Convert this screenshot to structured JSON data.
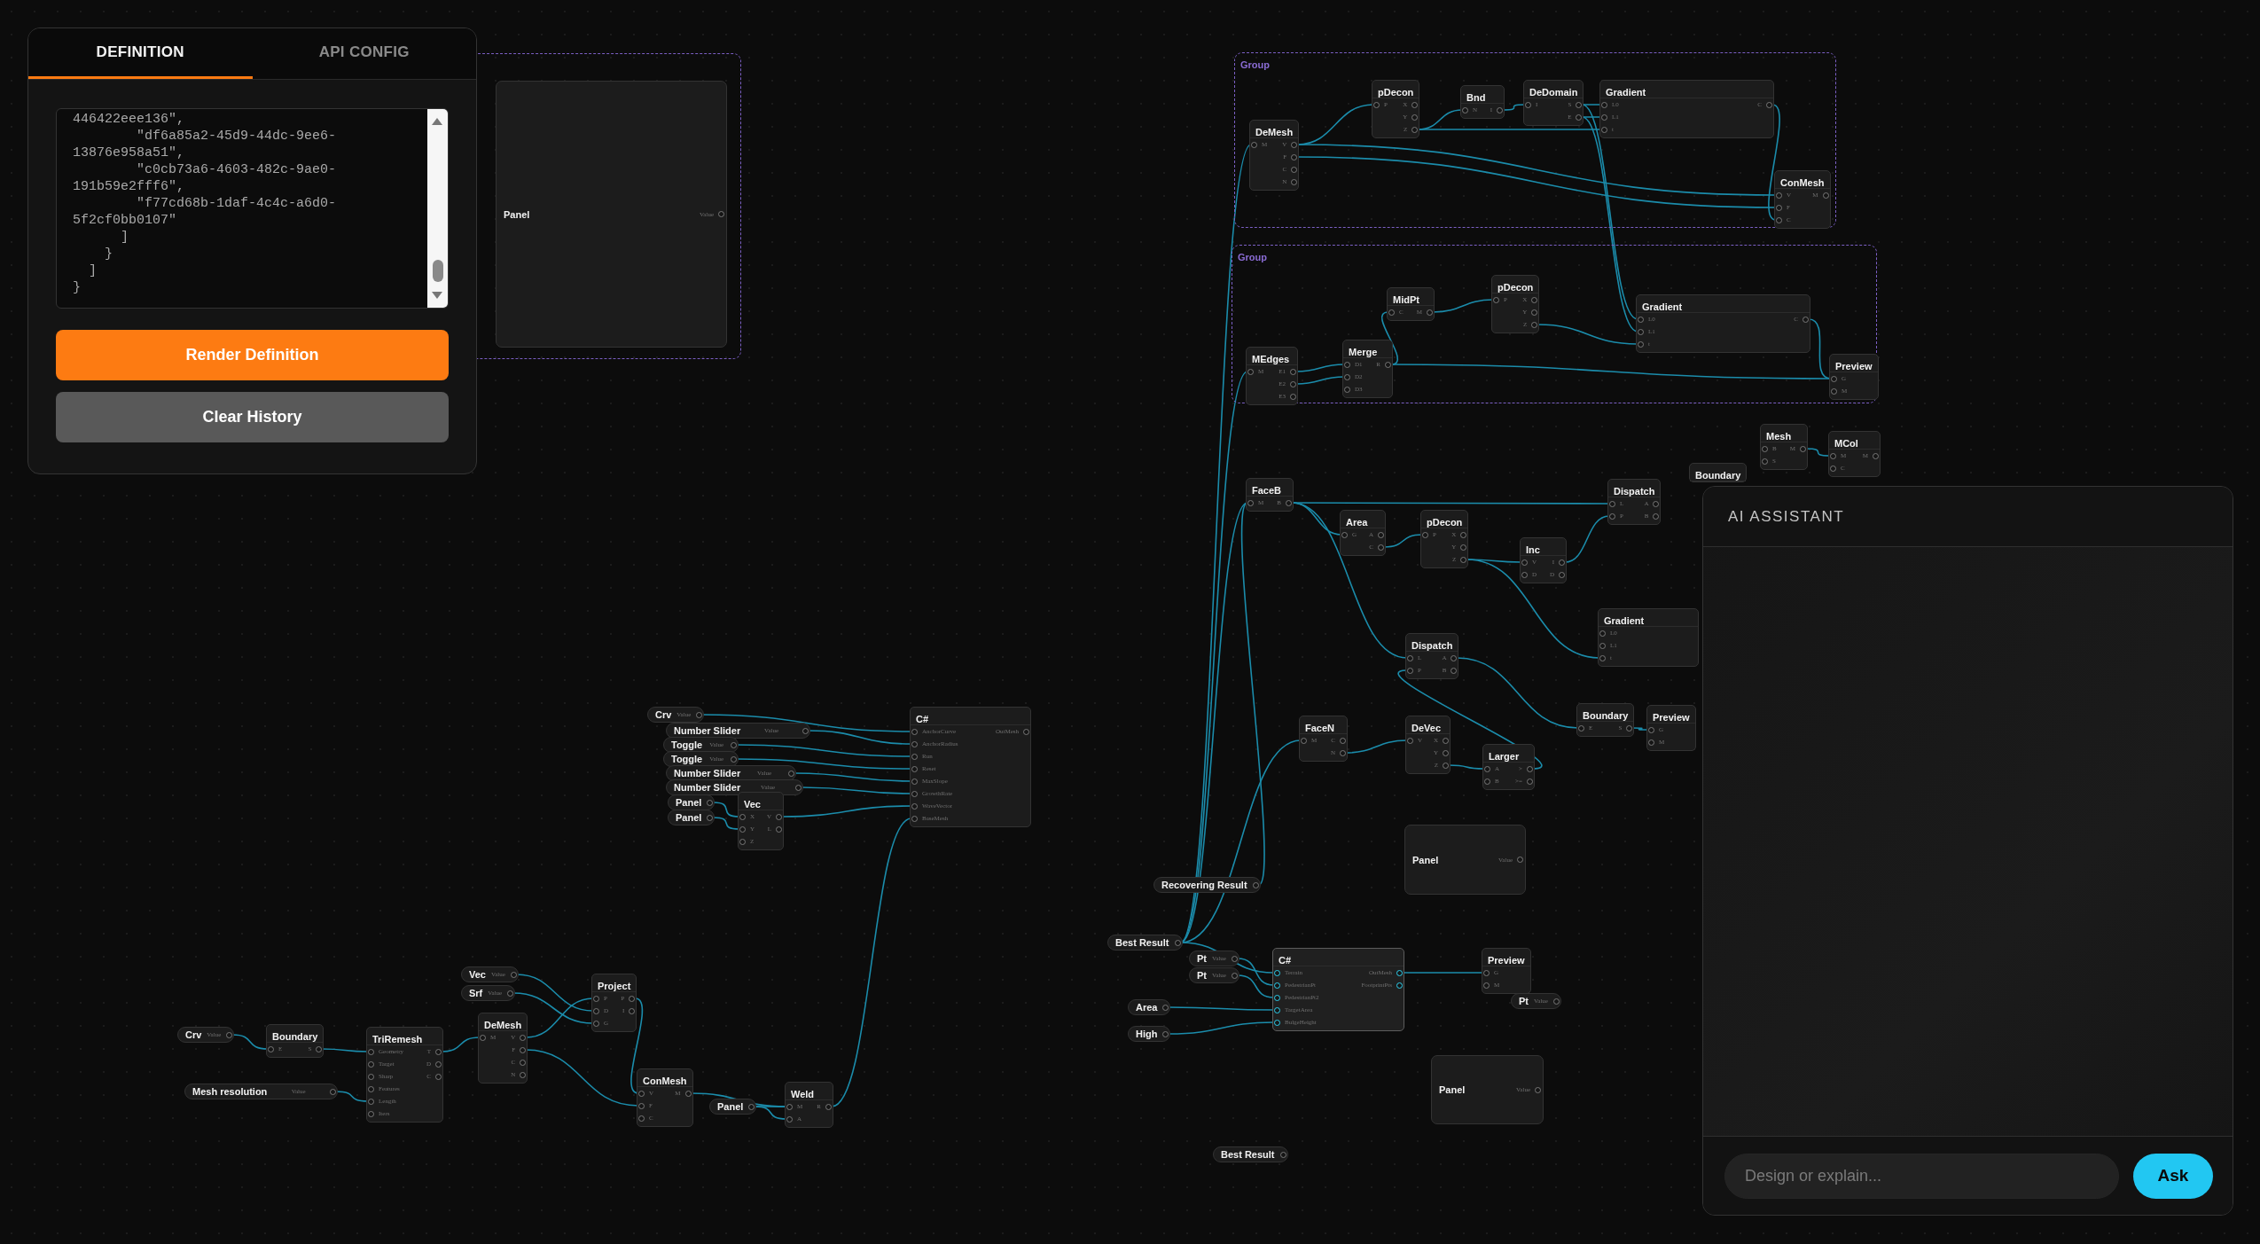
{
  "definition_panel": {
    "tabs": [
      {
        "label": "DEFINITION",
        "selected": true
      },
      {
        "label": "API CONFIG",
        "selected": false
      }
    ],
    "definition_text": "446422eee136\",\n        \"df6a85a2-45d9-44dc-9ee6-\n13876e958a51\",\n        \"c0cb73a6-4603-482c-9ae0-\n191b59e2fff6\",\n        \"f77cd68b-1daf-4c4c-a6d0-\n5f2cf0bb0107\"\n      ]\n    }\n  ]\n}",
    "buttons": [
      {
        "label": "Render Definition",
        "kind": "primary"
      },
      {
        "label": "Clear History",
        "kind": "secondary"
      }
    ]
  },
  "nodes": [
    {
      "kind": "group"
    },
    {
      "kind": "panel",
      "title": "Panel",
      "outputs": [
        "Value"
      ],
      "selected": false
    },
    {
      "kind": "group",
      "label": "Group"
    },
    {
      "kind": "component",
      "title": "DeMesh",
      "inputs": [
        "M"
      ],
      "outputs": [
        "V",
        "F",
        "C",
        "N"
      ],
      "selected": false
    },
    {
      "kind": "component",
      "title": "pDecon",
      "inputs": [
        "P"
      ],
      "outputs": [
        "X",
        "Y",
        "Z"
      ],
      "selected": false
    },
    {
      "kind": "component",
      "title": "Bnd",
      "inputs": [
        "N"
      ],
      "outputs": [
        "I"
      ],
      "selected": false
    },
    {
      "kind": "component",
      "title": "DeDomain",
      "inputs": [
        "I"
      ],
      "outputs": [
        "S",
        "E"
      ],
      "selected": false
    },
    {
      "kind": "component",
      "title": "Gradient",
      "inputs": [
        "L0",
        "L1",
        "t"
      ],
      "outputs": [
        "C"
      ],
      "selected": false
    },
    {
      "kind": "component",
      "title": "ConMesh",
      "inputs": [
        "V",
        "F",
        "C"
      ],
      "outputs": [
        "M"
      ],
      "selected": false
    },
    {
      "kind": "group",
      "label": "Group"
    },
    {
      "kind": "component",
      "title": "MidPt",
      "inputs": [
        "C"
      ],
      "outputs": [
        "M"
      ],
      "selected": false
    },
    {
      "kind": "component",
      "title": "pDecon",
      "inputs": [
        "P"
      ],
      "outputs": [
        "X",
        "Y",
        "Z"
      ],
      "selected": false
    },
    {
      "kind": "component",
      "title": "Gradient",
      "inputs": [
        "L0",
        "L1",
        "t"
      ],
      "outputs": [
        "C"
      ],
      "selected": false
    },
    {
      "kind": "component",
      "title": "MEdges",
      "inputs": [
        "M"
      ],
      "outputs": [
        "E1",
        "E2",
        "E3"
      ],
      "selected": false
    },
    {
      "kind": "component",
      "title": "Merge",
      "inputs": [
        "D1",
        "D2",
        "D3"
      ],
      "outputs": [
        "R"
      ],
      "selected": false
    },
    {
      "kind": "component",
      "title": "Preview",
      "inputs": [
        "G",
        "M"
      ],
      "selected": false
    },
    {
      "kind": "component",
      "title": "FaceB",
      "inputs": [
        "M"
      ],
      "outputs": [
        "B"
      ],
      "selected": false
    },
    {
      "kind": "component",
      "title": "Area",
      "inputs": [
        "G"
      ],
      "outputs": [
        "A",
        "C"
      ],
      "selected": false
    },
    {
      "kind": "component",
      "title": "pDecon",
      "inputs": [
        "P"
      ],
      "outputs": [
        "X",
        "Y",
        "Z"
      ],
      "selected": false
    },
    {
      "kind": "component",
      "title": "Inc",
      "inputs": [
        "V",
        "D"
      ],
      "outputs": [
        "I",
        "D"
      ],
      "selected": false
    },
    {
      "kind": "component",
      "title": "Dispatch",
      "inputs": [
        "L",
        "P"
      ],
      "outputs": [
        "A",
        "B"
      ],
      "selected": false
    },
    {
      "kind": "component",
      "title": "Boundary",
      "selected": false
    },
    {
      "kind": "component",
      "title": "Mesh",
      "inputs": [
        "B",
        "S"
      ],
      "outputs": [
        "M"
      ],
      "selected": false
    },
    {
      "kind": "component",
      "title": "MCol",
      "inputs": [
        "M",
        "C"
      ],
      "outputs": [
        "M"
      ],
      "selected": false
    },
    {
      "kind": "component",
      "title": "Gradient",
      "inputs": [
        "L0",
        "L1",
        "t"
      ],
      "selected": false
    },
    {
      "kind": "component",
      "title": "Dispatch",
      "inputs": [
        "L",
        "P"
      ],
      "outputs": [
        "A",
        "B"
      ],
      "selected": false
    },
    {
      "kind": "component",
      "title": "Boundary",
      "inputs": [
        "E"
      ],
      "outputs": [
        "S"
      ],
      "selected": false
    },
    {
      "kind": "component",
      "title": "Preview",
      "inputs": [
        "G",
        "M"
      ],
      "selected": false
    },
    {
      "kind": "component",
      "title": "FaceN",
      "inputs": [
        "M"
      ],
      "outputs": [
        "C",
        "N"
      ],
      "selected": false
    },
    {
      "kind": "component",
      "title": "DeVec",
      "inputs": [
        "V"
      ],
      "outputs": [
        "X",
        "Y",
        "Z"
      ],
      "selected": false
    },
    {
      "kind": "component",
      "title": "Larger",
      "inputs": [
        "A",
        "B"
      ],
      "outputs": [
        ">",
        ">="
      ],
      "selected": false
    },
    {
      "kind": "panel",
      "title": "Panel",
      "outputs": [
        "Value"
      ],
      "selected": false
    },
    {
      "kind": "param",
      "title": "Recovering Result",
      "selected": false
    },
    {
      "kind": "param",
      "title": "Best Result",
      "selected": false
    },
    {
      "kind": "param",
      "title": "Pt",
      "value_label": "Value",
      "selected": false
    },
    {
      "kind": "param",
      "title": "Pt",
      "value_label": "Value",
      "selected": false
    },
    {
      "kind": "component",
      "title": "C#",
      "inputs": [
        "Terrain",
        "PedestrianPt",
        "PedestrianPt2",
        "TargetArea",
        "BulgeHeight"
      ],
      "outputs": [
        "OutMesh",
        "FootprintPts"
      ],
      "selected": true
    },
    {
      "kind": "component",
      "title": "Preview",
      "inputs": [
        "G",
        "M"
      ],
      "selected": false
    },
    {
      "kind": "param",
      "title": "Pt",
      "value_label": "Value",
      "selected": false
    },
    {
      "kind": "param",
      "title": "Area",
      "selected": false
    },
    {
      "kind": "param",
      "title": "High",
      "selected": false
    },
    {
      "kind": "panel",
      "title": "Panel",
      "outputs": [
        "Value"
      ],
      "selected": false
    },
    {
      "kind": "param",
      "title": "Best Result",
      "selected": false
    },
    {
      "kind": "param",
      "title": "Crv",
      "value_label": "Value",
      "selected": false
    },
    {
      "kind": "param",
      "title": "Number Slider",
      "value_label": "Value",
      "selected": false
    },
    {
      "kind": "param",
      "title": "Toggle",
      "value_label": "Value",
      "selected": false
    },
    {
      "kind": "param",
      "title": "Toggle",
      "value_label": "Value",
      "selected": false
    },
    {
      "kind": "param",
      "title": "Number Slider",
      "value_label": "Value",
      "selected": false
    },
    {
      "kind": "param",
      "title": "Number Slider",
      "value_label": "Value",
      "selected": false
    },
    {
      "kind": "param",
      "title": "Panel",
      "selected": false
    },
    {
      "kind": "param",
      "title": "Panel",
      "selected": false
    },
    {
      "kind": "component",
      "title": "Vec",
      "inputs": [
        "X",
        "Y",
        "Z"
      ],
      "outputs": [
        "V",
        "L"
      ],
      "selected": false
    },
    {
      "kind": "component",
      "title": "C#",
      "inputs": [
        "AnchorCurve",
        "AnchorRadius",
        "Run",
        "Reset",
        "MaxSlope",
        "GrowthRate",
        "WaveVector",
        "BaseMesh"
      ],
      "outputs": [
        "OutMesh"
      ],
      "selected": false
    },
    {
      "kind": "param",
      "title": "Crv",
      "value_label": "Value",
      "selected": false
    },
    {
      "kind": "component",
      "title": "Boundary",
      "inputs": [
        "E"
      ],
      "outputs": [
        "S"
      ],
      "selected": false
    },
    {
      "kind": "component",
      "title": "TriRemesh",
      "inputs": [
        "Geometry",
        "Target",
        "Sharp",
        "Features",
        "Length",
        "Iters"
      ],
      "outputs": [
        "T",
        "D",
        "C"
      ],
      "selected": false
    },
    {
      "kind": "param",
      "title": "Mesh resolution",
      "value_label": "Value",
      "selected": false
    },
    {
      "kind": "param",
      "title": "Vec",
      "value_label": "Value",
      "selected": false
    },
    {
      "kind": "param",
      "title": "Srf",
      "value_label": "Value",
      "selected": false
    },
    {
      "kind": "component",
      "title": "DeMesh",
      "inputs": [
        "M"
      ],
      "outputs": [
        "V",
        "F",
        "C",
        "N"
      ],
      "selected": false
    },
    {
      "kind": "component",
      "title": "Project",
      "inputs": [
        "P",
        "D",
        "G"
      ],
      "outputs": [
        "P",
        "I"
      ],
      "selected": false
    },
    {
      "kind": "component",
      "title": "ConMesh",
      "inputs": [
        "V",
        "F",
        "C"
      ],
      "outputs": [
        "M"
      ],
      "selected": false
    },
    {
      "kind": "param",
      "title": "Panel",
      "selected": false
    },
    {
      "kind": "component",
      "title": "Weld",
      "inputs": [
        "M",
        "A"
      ],
      "outputs": [
        "R"
      ],
      "selected": false
    }
  ],
  "assistant": {
    "title": "AI ASSISTANT",
    "input": {
      "placeholder": "Design or explain..."
    },
    "button": "Ask"
  }
}
